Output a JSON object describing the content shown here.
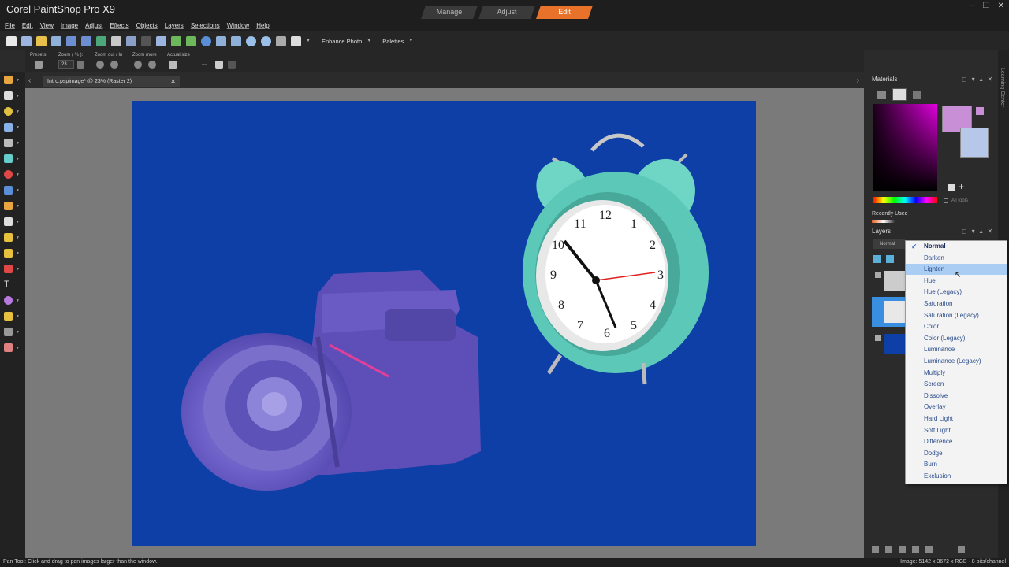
{
  "app": {
    "title": "Corel PaintShop Pro X9",
    "modes": [
      "Manage",
      "Adjust",
      "Edit"
    ],
    "active_mode": "Edit",
    "window_controls": [
      "–",
      "❐",
      "✕"
    ]
  },
  "menu": [
    "File",
    "Edit",
    "View",
    "Image",
    "Adjust",
    "Effects",
    "Objects",
    "Layers",
    "Selections",
    "Window",
    "Help"
  ],
  "toolbar": {
    "enhance_photo": "Enhance Photo",
    "palettes": "Palettes"
  },
  "tool_options": {
    "presets_label": "Presets:",
    "zoom_label": "Zoom ( % ):",
    "zoom_value": "23",
    "zoom_out_label": "Zoom out / In",
    "zoom_more_label": "Zoom more",
    "actual_size_label": "Actual size"
  },
  "document": {
    "tab_label": "Intro.pspimage* @  23% (Raster 2)",
    "close": "✕"
  },
  "materials": {
    "title": "Materials",
    "recently_used": "Recently Used",
    "all_tools": "All tools",
    "foreground_color": "#c88fd6",
    "background_color": "#b7c7ea"
  },
  "layers": {
    "title": "Layers",
    "blend_mode": "Normal"
  },
  "blend_menu": {
    "items": [
      "Normal",
      "Darken",
      "Lighten",
      "Hue",
      "Hue (Legacy)",
      "Saturation",
      "Saturation (Legacy)",
      "Color",
      "Color (Legacy)",
      "Luminance",
      "Luminance (Legacy)",
      "Multiply",
      "Screen",
      "Dissolve",
      "Overlay",
      "Hard Light",
      "Soft Light",
      "Difference",
      "Dodge",
      "Burn",
      "Exclusion"
    ],
    "checked": "Normal",
    "hovered": "Lighten",
    "check_mark": "✓"
  },
  "learning_center": "Learning Center",
  "status": {
    "left": "Pan Tool: Click and drag to pan images larger than the window.",
    "right": "Image: 5142 x 3672 x RGB - 8 bits/channel"
  },
  "clock": {
    "numbers": [
      "12",
      "1",
      "2",
      "3",
      "4",
      "5",
      "6",
      "7",
      "8",
      "9",
      "10",
      "11"
    ]
  },
  "colors": {
    "canvas": "#0d3fa6",
    "accent": "#e8722a",
    "clock_body": "#5fd0c0"
  }
}
